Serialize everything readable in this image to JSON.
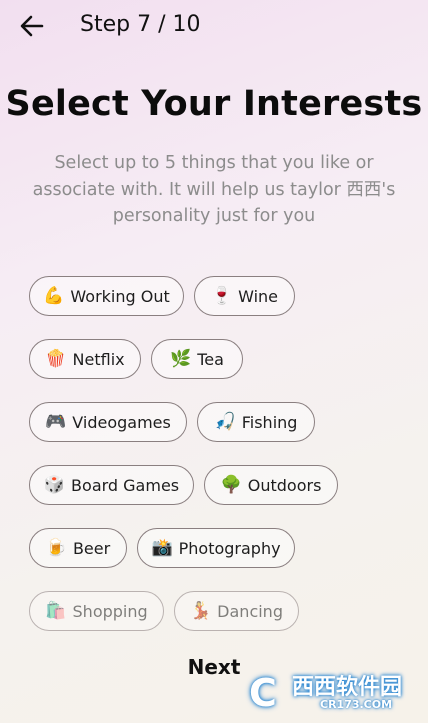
{
  "header": {
    "back_icon": "arrow-left-icon",
    "step": "Step 7 / 10"
  },
  "main": {
    "title": "Select Your Interests",
    "subtitle": "Select up to 5 things that you like or associate with. It will help us taylor 西西's personality just for you"
  },
  "interests": [
    {
      "emoji": "💪",
      "label": "Working Out",
      "icon": "flexed-biceps-icon"
    },
    {
      "emoji": "🍷",
      "label": "Wine",
      "icon": "wine-glass-icon"
    },
    {
      "emoji": "🍿",
      "label": "Netflix",
      "icon": "popcorn-icon"
    },
    {
      "emoji": "🌿",
      "label": "Tea",
      "icon": "herb-icon"
    },
    {
      "emoji": "🎮",
      "label": "Videogames",
      "icon": "game-controller-icon"
    },
    {
      "emoji": "🎣",
      "label": "Fishing",
      "icon": "fishing-pole-icon"
    },
    {
      "emoji": "🎲",
      "label": "Board Games",
      "icon": "dice-icon"
    },
    {
      "emoji": "🌳",
      "label": "Outdoors",
      "icon": "tree-icon"
    },
    {
      "emoji": "🍺",
      "label": "Beer",
      "icon": "beer-mug-icon"
    },
    {
      "emoji": "📸",
      "label": "Photography",
      "icon": "camera-icon"
    },
    {
      "emoji": "🛍️",
      "label": "Shopping",
      "icon": "shopping-bags-icon"
    },
    {
      "emoji": "💃",
      "label": "Dancing",
      "icon": "dancer-icon"
    }
  ],
  "footer": {
    "next_label": "Next"
  },
  "watermark": {
    "mark": "C",
    "name": "西西软件园",
    "domain": "CR173.COM"
  }
}
